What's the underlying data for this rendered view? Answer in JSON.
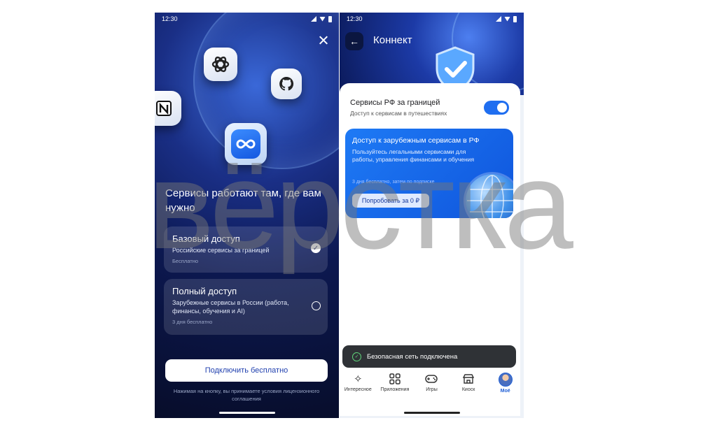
{
  "left_screen": {
    "status_time": "12:30",
    "headline": "Сервисы работают там, где вам нужно",
    "options": [
      {
        "title": "Базовый доступ",
        "subtitle": "Российские сервисы за границей",
        "note": "Бесплатно",
        "selected": true
      },
      {
        "title": "Полный доступ",
        "subtitle": "Зарубежные сервисы в России (работа, финансы, обучения и AI)",
        "note": "3 дня бесплатно",
        "selected": false
      }
    ],
    "cta_label": "Подключить бесплатно",
    "legal_text": "Нажимая на кнопку, вы принимаете условия лицензионного соглашения",
    "icons": [
      "chatgpt-icon",
      "github-icon",
      "notion-icon",
      "infinity-icon"
    ]
  },
  "right_screen": {
    "status_time": "12:30",
    "title": "Коннект",
    "toggle_title": "Сервисы РФ за границей",
    "toggle_subtitle": "Доступ к сервисам в путешествиях",
    "toggle_on": true,
    "promo_title": "Доступ к зарубежным сервисам в РФ",
    "promo_desc": "Пользуйтесь легальными сервисами для работы, управления финансами и обучения",
    "promo_note": "3 дня бесплатно, затем по подписке",
    "promo_button": "Попробовать за 0 ₽",
    "toast_text": "Безопасная сеть подключена",
    "nav": [
      {
        "label": "Интересное",
        "icon": "sparkle-icon"
      },
      {
        "label": "Приложения",
        "icon": "apps-grid-icon"
      },
      {
        "label": "Игры",
        "icon": "gamepad-icon"
      },
      {
        "label": "Киоск",
        "icon": "kiosk-icon"
      },
      {
        "label": "Моё",
        "icon": "avatar-icon",
        "active": true
      }
    ]
  },
  "watermark": "вёрстка",
  "colors": {
    "accent": "#1f6ef0",
    "dark_bg": "#0c1850",
    "toast_bg": "#2f3236"
  }
}
